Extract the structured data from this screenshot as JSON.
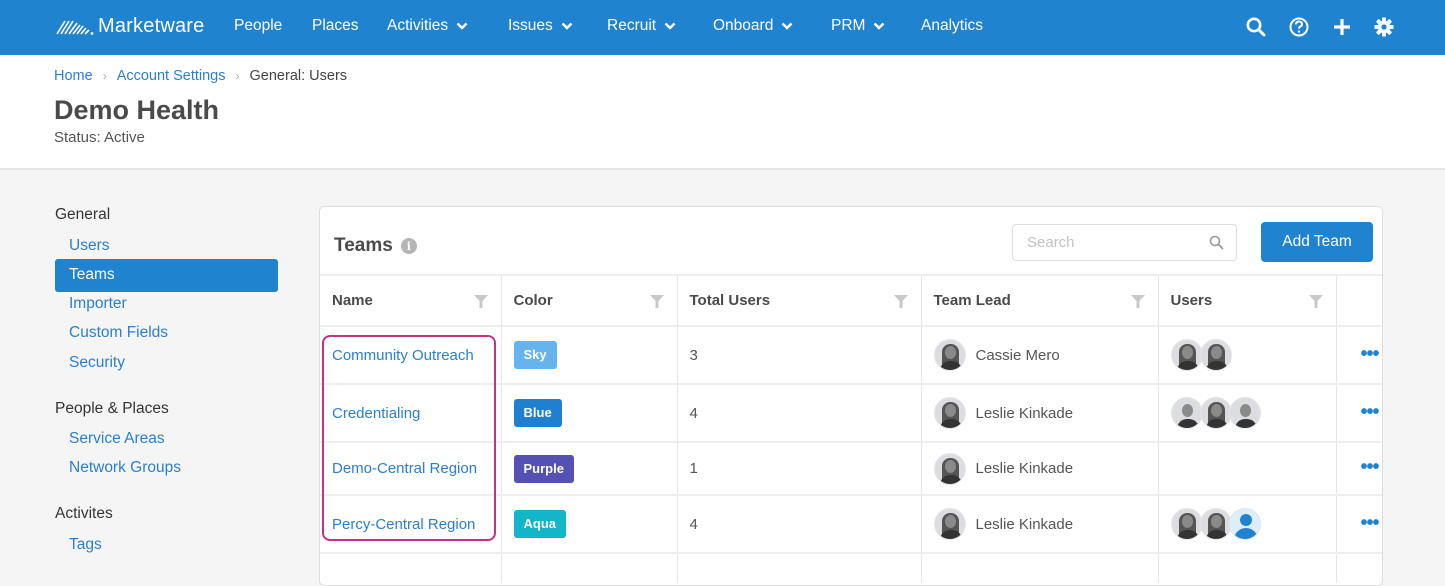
{
  "app": {
    "brand": "Marketware"
  },
  "nav": {
    "items": [
      {
        "label": "People",
        "has_dropdown": false
      },
      {
        "label": "Places",
        "has_dropdown": false
      },
      {
        "label": "Activities",
        "has_dropdown": true
      },
      {
        "label": "Issues",
        "has_dropdown": true
      },
      {
        "label": "Recruit",
        "has_dropdown": true
      },
      {
        "label": "Onboard",
        "has_dropdown": true
      },
      {
        "label": "PRM",
        "has_dropdown": true
      },
      {
        "label": "Analytics",
        "has_dropdown": false
      }
    ],
    "icons": [
      "search-icon",
      "help-icon",
      "plus-icon",
      "gear-icon"
    ]
  },
  "breadcrumb": {
    "items": [
      "Home",
      "Account Settings"
    ],
    "current": "General: Users"
  },
  "page": {
    "title": "Demo Health",
    "status": "Status: Active"
  },
  "sidebar": {
    "groups": [
      {
        "label": "General",
        "items": [
          {
            "label": "Users",
            "active": false
          },
          {
            "label": "Teams",
            "active": true
          },
          {
            "label": "Importer",
            "active": false
          },
          {
            "label": "Custom Fields",
            "active": false
          },
          {
            "label": "Security",
            "active": false
          }
        ]
      },
      {
        "label": "People & Places",
        "items": [
          {
            "label": "Service Areas",
            "active": false
          },
          {
            "label": "Network Groups",
            "active": false
          }
        ]
      },
      {
        "label": "Activites",
        "items": [
          {
            "label": "Tags",
            "active": false
          }
        ]
      }
    ]
  },
  "teams": {
    "title": "Teams",
    "search_placeholder": "Search",
    "search_value": "",
    "add_button": "Add Team",
    "columns": [
      "Name",
      "Color",
      "Total Users",
      "Team Lead",
      "Users",
      ""
    ],
    "rows": [
      {
        "name": "Community Outreach",
        "color_label": "Sky",
        "color_hex": "#66b4ee",
        "total_users": "3",
        "team_lead": "Cassie Mero",
        "user_avatars": [
          "woman",
          "woman"
        ]
      },
      {
        "name": "Credentialing",
        "color_label": "Blue",
        "color_hex": "#1f7fd0",
        "total_users": "4",
        "team_lead": "Leslie Kinkade",
        "user_avatars": [
          "man",
          "woman",
          "man"
        ]
      },
      {
        "name": "Demo-Central Region",
        "color_label": "Purple",
        "color_hex": "#5450b4",
        "total_users": "1",
        "team_lead": "Leslie Kinkade",
        "user_avatars": []
      },
      {
        "name": "Percy-Central Region",
        "color_label": "Aqua",
        "color_hex": "#12b6c8",
        "total_users": "4",
        "team_lead": "Leslie Kinkade",
        "user_avatars": [
          "woman",
          "woman",
          "generic"
        ]
      }
    ],
    "row_action": "more-options"
  },
  "colors": {
    "brand": "#2083d0",
    "link": "#2a7fd0",
    "highlight_outline": "#c4318a"
  }
}
